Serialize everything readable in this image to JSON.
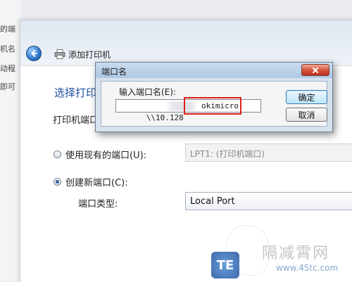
{
  "background": {
    "left_fragments": [
      "的端",
      "机名",
      "动程",
      "即可"
    ]
  },
  "wizard": {
    "title": "添加打印机",
    "section_title": "选择打印",
    "port_description": "打印机端口",
    "use_existing_label": "使用现有的端口(U):",
    "use_existing_value": "LPT1: (打印机端口)",
    "create_new_label": "创建新端口(C):",
    "port_type_label": "端口类型:",
    "port_type_value": "Local Port",
    "selected_option": "create_new"
  },
  "dialog": {
    "title": "端口名",
    "prompt": "输入端口名(E):",
    "input_prefix": "\\\\10.128",
    "input_suffix": "okimicro",
    "ok_label": "确定",
    "cancel_label": "取消"
  },
  "watermark": {
    "brand": "隔减霄网",
    "url": "www.45tc.com",
    "logo_text": "TE"
  },
  "colors": {
    "accent": "#1e4fa0",
    "highlight_box": "#e0201c",
    "close_button": "#d3523a"
  }
}
